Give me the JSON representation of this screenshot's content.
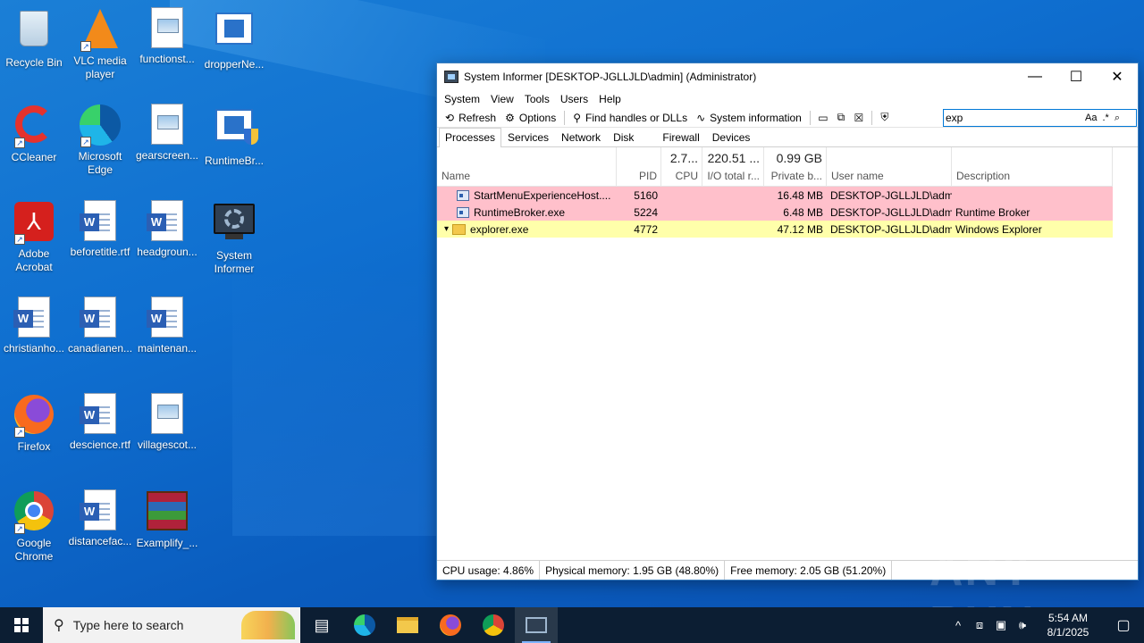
{
  "desktop": {
    "icons": [
      {
        "label": "Recycle Bin"
      },
      {
        "label": "VLC media player"
      },
      {
        "label": "functionst..."
      },
      {
        "label": "dropperNe..."
      },
      {
        "label": "CCleaner"
      },
      {
        "label": "Microsoft Edge"
      },
      {
        "label": "gearscreen..."
      },
      {
        "label": "RuntimeBr..."
      },
      {
        "label": "Adobe Acrobat"
      },
      {
        "label": "beforetitle.rtf"
      },
      {
        "label": "headgroun..."
      },
      {
        "label": "System Informer"
      },
      {
        "label": "christianho..."
      },
      {
        "label": "canadianen..."
      },
      {
        "label": "maintenan..."
      },
      {
        "label": "Firefox"
      },
      {
        "label": "descience.rtf"
      },
      {
        "label": "villagescot..."
      },
      {
        "label": "Google Chrome"
      },
      {
        "label": "distancefac..."
      },
      {
        "label": "Examplify_..."
      }
    ]
  },
  "window": {
    "title": "System Informer [DESKTOP-JGLLJLD\\admin] (Administrator)",
    "controls": {
      "minimize": "—",
      "maximize": "☐",
      "close": "✕"
    },
    "menu": [
      "System",
      "View",
      "Tools",
      "Users",
      "Help"
    ],
    "toolbar": {
      "refresh": "Refresh",
      "options": "Options",
      "find_handles": "Find handles or DLLs",
      "system_information": "System information"
    },
    "search": {
      "value": "exp",
      "case_label": "Aa",
      "regex_label": ".*"
    },
    "tabs": [
      "Processes",
      "Services",
      "Network",
      "Disk",
      "Firewall",
      "Devices"
    ],
    "columns": {
      "name": "Name",
      "pid": "PID",
      "cpu": "CPU",
      "io": "I/O total r...",
      "private": "Private b...",
      "user": "User name",
      "description": "Description",
      "cpu_total": "2.7...",
      "io_total": "220.51 ...",
      "private_total": "0.99 GB"
    },
    "rows": [
      {
        "name": "StartMenuExperienceHost....",
        "pid": "5160",
        "cpu": "",
        "io": "",
        "private": "16.48 MB",
        "user": "DESKTOP-JGLLJLD\\admi",
        "description": ""
      },
      {
        "name": "RuntimeBroker.exe",
        "pid": "5224",
        "cpu": "",
        "io": "",
        "private": "6.48 MB",
        "user": "DESKTOP-JGLLJLD\\admi",
        "description": "Runtime Broker"
      },
      {
        "name": "explorer.exe",
        "pid": "4772",
        "cpu": "",
        "io": "",
        "private": "47.12 MB",
        "user": "DESKTOP-JGLLJLD\\admi",
        "description": "Windows Explorer"
      }
    ],
    "status": {
      "cpu": "CPU usage: 4.86%",
      "physical": "Physical memory: 1.95 GB (48.80%)",
      "free": "Free memory: 2.05 GB (51.20%)"
    }
  },
  "taskbar": {
    "search_placeholder": "Type here to search",
    "time": "5:54 AM",
    "date": "8/1/2025"
  },
  "watermark": "ANY RUN",
  "colors": {
    "row_pink": "#ffc0cb",
    "row_yellow": "#ffffaa",
    "taskbar": "#0c1e33"
  }
}
